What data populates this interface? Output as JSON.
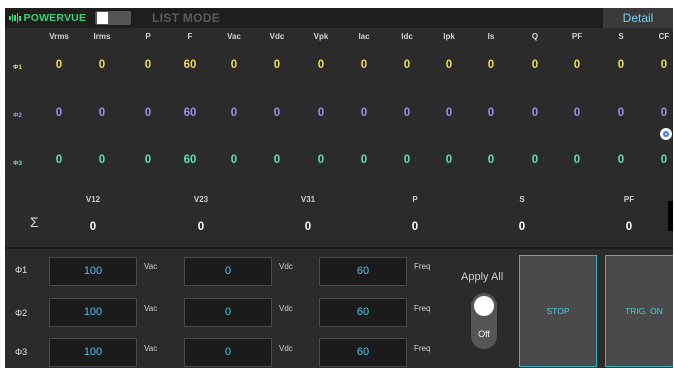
{
  "header": {
    "logo_text": "POWERVUE",
    "mode_label": "LIST MODE",
    "detail_label": "Detail"
  },
  "table": {
    "columns": [
      "Vrms",
      "Irms",
      "P",
      "F",
      "Vac",
      "Vdc",
      "Vpk",
      "Iac",
      "Idc",
      "Ipk",
      "Is",
      "Q",
      "PF",
      "S",
      "CF"
    ],
    "rows": [
      {
        "phase": "Φ1",
        "values": [
          "0",
          "0",
          "0",
          "60",
          "0",
          "0",
          "0",
          "0",
          "0",
          "0",
          "0",
          "0",
          "0",
          "0",
          "0"
        ]
      },
      {
        "phase": "Φ2",
        "values": [
          "0",
          "0",
          "0",
          "60",
          "0",
          "0",
          "0",
          "0",
          "0",
          "0",
          "0",
          "0",
          "0",
          "0",
          "0"
        ]
      },
      {
        "phase": "Φ3",
        "values": [
          "0",
          "0",
          "0",
          "60",
          "0",
          "0",
          "0",
          "0",
          "0",
          "0",
          "0",
          "0",
          "0",
          "0",
          "0"
        ]
      }
    ]
  },
  "sum": {
    "symbol": "Σ",
    "headers": [
      "V12",
      "V23",
      "V31",
      "P",
      "S",
      "PF"
    ],
    "values": [
      "0",
      "0",
      "0",
      "0",
      "0",
      "0"
    ]
  },
  "controls": {
    "rows": [
      {
        "phase": "Φ1",
        "vac": "100",
        "vdc": "0",
        "freq": "60"
      },
      {
        "phase": "Φ2",
        "vac": "100",
        "vdc": "0",
        "freq": "60"
      },
      {
        "phase": "Φ3",
        "vac": "100",
        "vdc": "0",
        "freq": "60"
      }
    ],
    "units": {
      "vac": "Vac",
      "vdc": "Vdc",
      "freq": "Freq"
    },
    "apply_all_label": "Apply All",
    "apply_all_state": "Off",
    "stop_label": "STOP",
    "trig_label": "TRIG. ON"
  },
  "colors": {
    "phase1": "#e6de5a",
    "phase2": "#9f8ef0",
    "phase3": "#5ee0b2",
    "accent": "#4fc3f0",
    "brand": "#3ecf76"
  }
}
